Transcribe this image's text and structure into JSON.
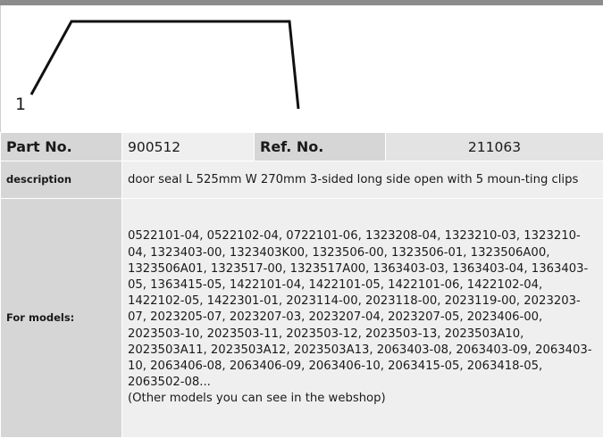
{
  "figure": {
    "label": "1"
  },
  "part": {
    "part_no_label": "Part No.",
    "part_no": "900512",
    "ref_no_label": "Ref. No.",
    "ref_no": "211063"
  },
  "description": {
    "label": "description",
    "text": "door seal  L 525mm W 270mm 3-sided long side open with 5 moun-ting clips"
  },
  "models": {
    "label": "For models:",
    "list": "0522101-04, 0522102-04, 0722101-06, 1323208-04, 1323210-03, 1323210-04, 1323403-00, 1323403K00, 1323506-00, 1323506-01, 1323506A00, 1323506A01, 1323517-00, 1323517A00, 1363403-03, 1363403-04, 1363403-05, 1363415-05, 1422101-04, 1422101-05, 1422101-06, 1422102-04, 1422102-05, 1422301-01, 2023114-00, 2023118-00, 2023119-00, 2023203-07, 2023205-07, 2023207-03, 2023207-04, 2023207-05, 2023406-00, 2023503-10, 2023503-11, 2023503-12, 2023503-13, 2023503A10, 2023503A11, 2023503A12, 2023503A13, 2063403-08, 2063403-09, 2063403-10, 2063406-08, 2063406-09, 2063406-10, 2063415-05, 2063418-05, 2063502-08...",
    "note": "(Other models you can see in the webshop)"
  }
}
